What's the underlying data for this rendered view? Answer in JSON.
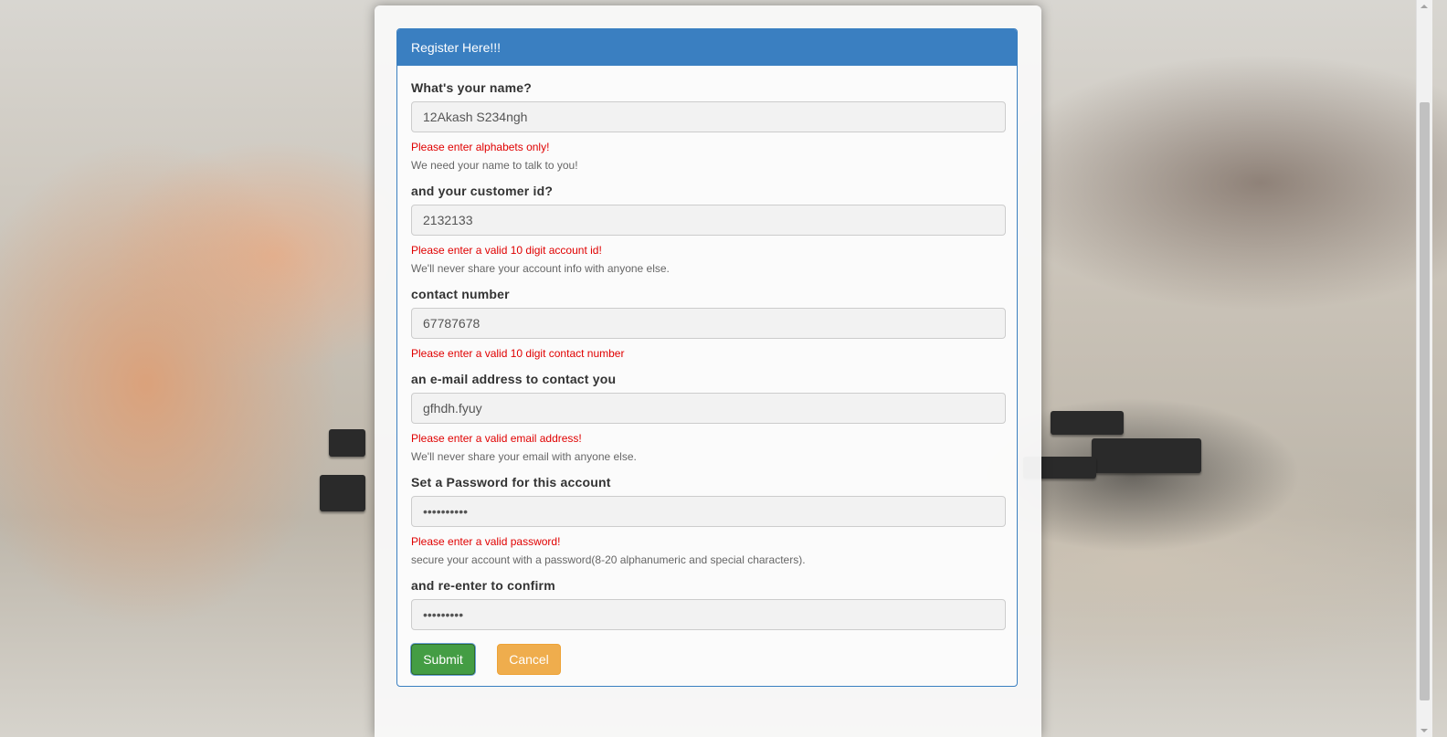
{
  "panel": {
    "title": "Register Here!!!"
  },
  "fields": {
    "name": {
      "label": "What's your name?",
      "value": "12Akash S234ngh",
      "error": "Please enter alphabets only!",
      "help": "We need your name to talk to you!"
    },
    "customer_id": {
      "label": "and your customer id?",
      "value": "2132133",
      "error": "Please enter a valid 10 digit account id!",
      "help": "We'll never share your account info with anyone else."
    },
    "contact": {
      "label": "contact number",
      "value": "67787678",
      "error": "Please enter a valid 10 digit contact number"
    },
    "email": {
      "label": "an e-mail address to contact you",
      "value": "gfhdh.fyuy",
      "error": "Please enter a valid email address!",
      "help": "We'll never share your email with anyone else."
    },
    "password": {
      "label": "Set a Password for this account",
      "value": "••••••••••",
      "error": "Please enter a valid password!",
      "help": "secure your account with a password(8-20 alphanumeric and special characters)."
    },
    "confirm": {
      "label": "and re-enter to confirm",
      "value": "•••••••••"
    }
  },
  "buttons": {
    "submit": "Submit",
    "cancel": "Cancel"
  },
  "colors": {
    "panel_header": "#3a7fc1",
    "error_text": "#e00000",
    "submit_button": "#449d44",
    "cancel_button": "#efad4d"
  }
}
